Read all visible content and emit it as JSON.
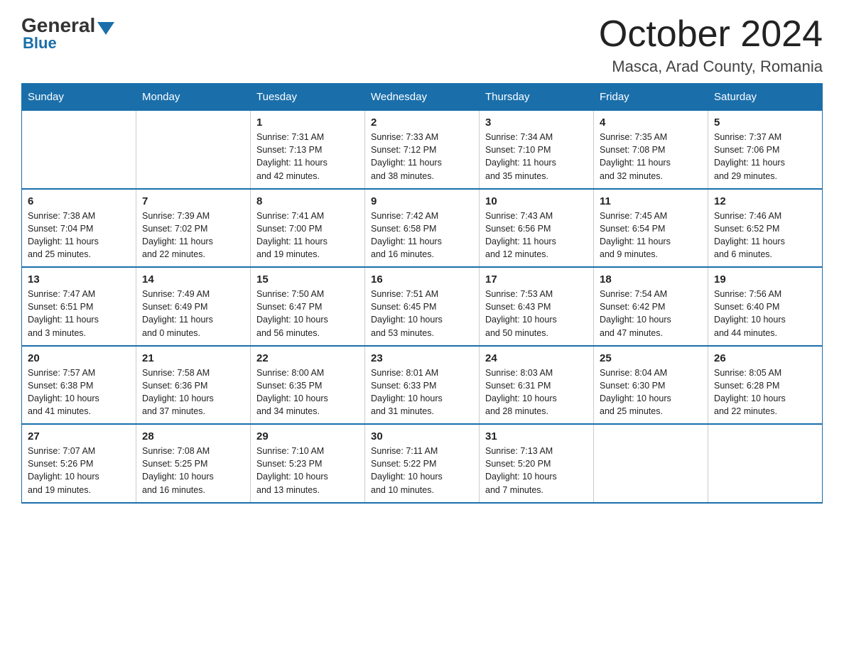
{
  "logo": {
    "general": "General",
    "blue": "Blue"
  },
  "title": "October 2024",
  "subtitle": "Masca, Arad County, Romania",
  "days_of_week": [
    "Sunday",
    "Monday",
    "Tuesday",
    "Wednesday",
    "Thursday",
    "Friday",
    "Saturday"
  ],
  "weeks": [
    [
      {
        "day": "",
        "info": ""
      },
      {
        "day": "",
        "info": ""
      },
      {
        "day": "1",
        "info": "Sunrise: 7:31 AM\nSunset: 7:13 PM\nDaylight: 11 hours\nand 42 minutes."
      },
      {
        "day": "2",
        "info": "Sunrise: 7:33 AM\nSunset: 7:12 PM\nDaylight: 11 hours\nand 38 minutes."
      },
      {
        "day": "3",
        "info": "Sunrise: 7:34 AM\nSunset: 7:10 PM\nDaylight: 11 hours\nand 35 minutes."
      },
      {
        "day": "4",
        "info": "Sunrise: 7:35 AM\nSunset: 7:08 PM\nDaylight: 11 hours\nand 32 minutes."
      },
      {
        "day": "5",
        "info": "Sunrise: 7:37 AM\nSunset: 7:06 PM\nDaylight: 11 hours\nand 29 minutes."
      }
    ],
    [
      {
        "day": "6",
        "info": "Sunrise: 7:38 AM\nSunset: 7:04 PM\nDaylight: 11 hours\nand 25 minutes."
      },
      {
        "day": "7",
        "info": "Sunrise: 7:39 AM\nSunset: 7:02 PM\nDaylight: 11 hours\nand 22 minutes."
      },
      {
        "day": "8",
        "info": "Sunrise: 7:41 AM\nSunset: 7:00 PM\nDaylight: 11 hours\nand 19 minutes."
      },
      {
        "day": "9",
        "info": "Sunrise: 7:42 AM\nSunset: 6:58 PM\nDaylight: 11 hours\nand 16 minutes."
      },
      {
        "day": "10",
        "info": "Sunrise: 7:43 AM\nSunset: 6:56 PM\nDaylight: 11 hours\nand 12 minutes."
      },
      {
        "day": "11",
        "info": "Sunrise: 7:45 AM\nSunset: 6:54 PM\nDaylight: 11 hours\nand 9 minutes."
      },
      {
        "day": "12",
        "info": "Sunrise: 7:46 AM\nSunset: 6:52 PM\nDaylight: 11 hours\nand 6 minutes."
      }
    ],
    [
      {
        "day": "13",
        "info": "Sunrise: 7:47 AM\nSunset: 6:51 PM\nDaylight: 11 hours\nand 3 minutes."
      },
      {
        "day": "14",
        "info": "Sunrise: 7:49 AM\nSunset: 6:49 PM\nDaylight: 11 hours\nand 0 minutes."
      },
      {
        "day": "15",
        "info": "Sunrise: 7:50 AM\nSunset: 6:47 PM\nDaylight: 10 hours\nand 56 minutes."
      },
      {
        "day": "16",
        "info": "Sunrise: 7:51 AM\nSunset: 6:45 PM\nDaylight: 10 hours\nand 53 minutes."
      },
      {
        "day": "17",
        "info": "Sunrise: 7:53 AM\nSunset: 6:43 PM\nDaylight: 10 hours\nand 50 minutes."
      },
      {
        "day": "18",
        "info": "Sunrise: 7:54 AM\nSunset: 6:42 PM\nDaylight: 10 hours\nand 47 minutes."
      },
      {
        "day": "19",
        "info": "Sunrise: 7:56 AM\nSunset: 6:40 PM\nDaylight: 10 hours\nand 44 minutes."
      }
    ],
    [
      {
        "day": "20",
        "info": "Sunrise: 7:57 AM\nSunset: 6:38 PM\nDaylight: 10 hours\nand 41 minutes."
      },
      {
        "day": "21",
        "info": "Sunrise: 7:58 AM\nSunset: 6:36 PM\nDaylight: 10 hours\nand 37 minutes."
      },
      {
        "day": "22",
        "info": "Sunrise: 8:00 AM\nSunset: 6:35 PM\nDaylight: 10 hours\nand 34 minutes."
      },
      {
        "day": "23",
        "info": "Sunrise: 8:01 AM\nSunset: 6:33 PM\nDaylight: 10 hours\nand 31 minutes."
      },
      {
        "day": "24",
        "info": "Sunrise: 8:03 AM\nSunset: 6:31 PM\nDaylight: 10 hours\nand 28 minutes."
      },
      {
        "day": "25",
        "info": "Sunrise: 8:04 AM\nSunset: 6:30 PM\nDaylight: 10 hours\nand 25 minutes."
      },
      {
        "day": "26",
        "info": "Sunrise: 8:05 AM\nSunset: 6:28 PM\nDaylight: 10 hours\nand 22 minutes."
      }
    ],
    [
      {
        "day": "27",
        "info": "Sunrise: 7:07 AM\nSunset: 5:26 PM\nDaylight: 10 hours\nand 19 minutes."
      },
      {
        "day": "28",
        "info": "Sunrise: 7:08 AM\nSunset: 5:25 PM\nDaylight: 10 hours\nand 16 minutes."
      },
      {
        "day": "29",
        "info": "Sunrise: 7:10 AM\nSunset: 5:23 PM\nDaylight: 10 hours\nand 13 minutes."
      },
      {
        "day": "30",
        "info": "Sunrise: 7:11 AM\nSunset: 5:22 PM\nDaylight: 10 hours\nand 10 minutes."
      },
      {
        "day": "31",
        "info": "Sunrise: 7:13 AM\nSunset: 5:20 PM\nDaylight: 10 hours\nand 7 minutes."
      },
      {
        "day": "",
        "info": ""
      },
      {
        "day": "",
        "info": ""
      }
    ]
  ]
}
